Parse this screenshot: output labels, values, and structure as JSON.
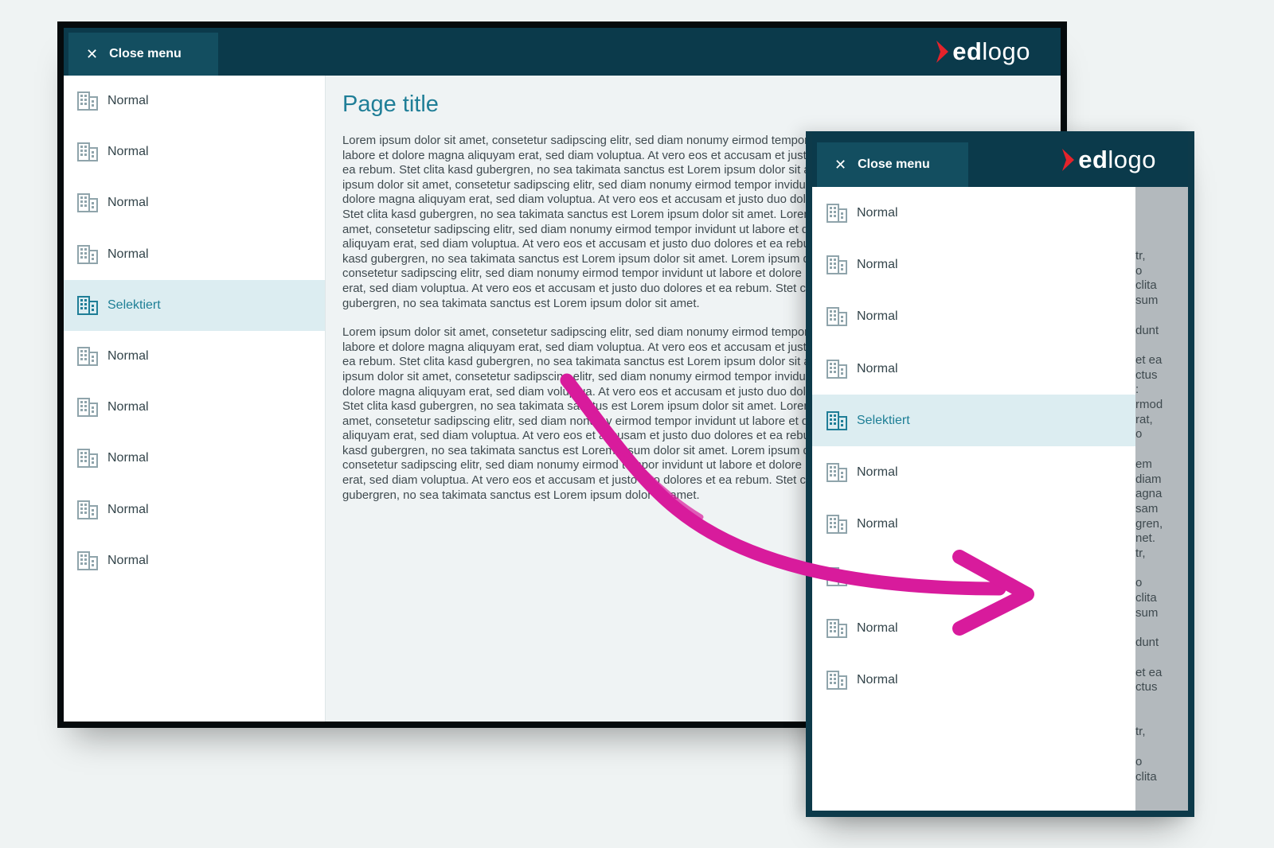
{
  "desktop": {
    "close_label": "Close menu",
    "close_icon": "close-icon",
    "logo": {
      "part1": "ed",
      "part2": "logo",
      "icon": "chevron-right-icon",
      "accent": "#e5232b"
    },
    "menu": [
      {
        "label": "Normal",
        "selected": false
      },
      {
        "label": "Normal",
        "selected": false
      },
      {
        "label": "Normal",
        "selected": false
      },
      {
        "label": "Normal",
        "selected": false
      },
      {
        "label": "Selektiert",
        "selected": true
      },
      {
        "label": "Normal",
        "selected": false
      },
      {
        "label": "Normal",
        "selected": false
      },
      {
        "label": "Normal",
        "selected": false
      },
      {
        "label": "Normal",
        "selected": false
      },
      {
        "label": "Normal",
        "selected": false
      }
    ],
    "page_title": "Page title",
    "paragraphs": [
      "Lorem ipsum dolor sit amet, consetetur sadipscing elitr, sed diam nonumy eirmod tempor invidunt ut labore et dolore magna aliquyam erat, sed diam voluptua. At vero eos et accusam et justo duo dolores et ea rebum. Stet clita kasd gubergren, no sea takimata sanctus est Lorem ipsum dolor sit amet. Lorem ipsum dolor sit amet, consetetur sadipscing elitr, sed diam nonumy eirmod tempor invidunt ut labore et dolore magna aliquyam erat, sed diam voluptua. At vero eos et accusam et justo duo dolores et ea rebum. Stet clita kasd gubergren, no sea takimata sanctus est Lorem ipsum dolor sit amet. Lorem ipsum dolor sit amet, consetetur sadipscing elitr, sed diam nonumy eirmod tempor invidunt ut labore et dolore magna aliquyam erat, sed diam voluptua. At vero eos et accusam et justo duo dolores et ea rebum. Stet clita kasd gubergren, no sea takimata sanctus est Lorem ipsum dolor sit amet. Lorem ipsum dolor sit amet, consetetur sadipscing elitr, sed diam nonumy eirmod tempor invidunt ut labore et dolore magna aliquyam erat, sed diam voluptua. At vero eos et accusam et justo duo dolores et ea rebum. Stet clita kasd gubergren, no sea takimata sanctus est Lorem ipsum dolor sit amet.",
      "Lorem ipsum dolor sit amet, consetetur sadipscing elitr, sed diam nonumy eirmod tempor invidunt ut labore et dolore magna aliquyam erat, sed diam voluptua. At vero eos et accusam et justo duo dolores et ea rebum. Stet clita kasd gubergren, no sea takimata sanctus est Lorem ipsum dolor sit amet. Lorem ipsum dolor sit amet, consetetur sadipscing elitr, sed diam nonumy eirmod tempor invidunt ut labore et dolore magna aliquyam erat, sed diam voluptua. At vero eos et accusam et justo duo dolores et ea rebum. Stet clita kasd gubergren, no sea takimata sanctus est Lorem ipsum dolor sit amet. Lorem ipsum dolor sit amet, consetetur sadipscing elitr, sed diam nonumy eirmod tempor invidunt ut labore et dolore magna aliquyam erat, sed diam voluptua. At vero eos et accusam et justo duo dolores et ea rebum. Stet clita kasd gubergren, no sea takimata sanctus est Lorem ipsum dolor sit amet. Lorem ipsum dolor sit amet, consetetur sadipscing elitr, sed diam nonumy eirmod tempor invidunt ut labore et dolore magna aliquyam erat, sed diam voluptua. At vero eos et accusam et justo duo dolores et ea rebum. Stet clita kasd gubergren, no sea takimata sanctus est Lorem ipsum dolor sit amet."
    ]
  },
  "mobile": {
    "close_label": "Close menu",
    "close_icon": "close-icon",
    "logo": {
      "part1": "ed",
      "part2": "logo",
      "icon": "chevron-right-icon",
      "accent": "#e5232b"
    },
    "menu": [
      {
        "label": "Normal",
        "selected": false
      },
      {
        "label": "Normal",
        "selected": false
      },
      {
        "label": "Normal",
        "selected": false
      },
      {
        "label": "Normal",
        "selected": false
      },
      {
        "label": "Selektiert",
        "selected": true
      },
      {
        "label": "Normal",
        "selected": false
      },
      {
        "label": "Normal",
        "selected": false
      },
      {
        "label": "",
        "selected": false
      },
      {
        "label": "Normal",
        "selected": false
      },
      {
        "label": "Normal",
        "selected": false
      }
    ],
    "overlay_fragments": [
      "tr,",
      "o",
      "clita",
      "sum",
      "",
      "dunt",
      "",
      "et ea",
      "ctus",
      ":",
      "rmod",
      "rat,",
      "o",
      "",
      "em",
      "diam",
      "agna",
      "sam",
      "gren,",
      "net.",
      "tr,",
      "",
      "o",
      "clita",
      "sum",
      "",
      "dunt",
      "",
      "et ea",
      "ctus",
      "",
      "",
      "tr,",
      "",
      "o",
      "clita"
    ]
  },
  "colors": {
    "topbar": "#0b3a4b",
    "accent_teal": "#1f7e97",
    "selected_bg": "#dcedf1",
    "arrow": "#d81b9c",
    "logo_red": "#e5232b"
  },
  "annotation": {
    "icon": "arrow-annotation-icon"
  }
}
